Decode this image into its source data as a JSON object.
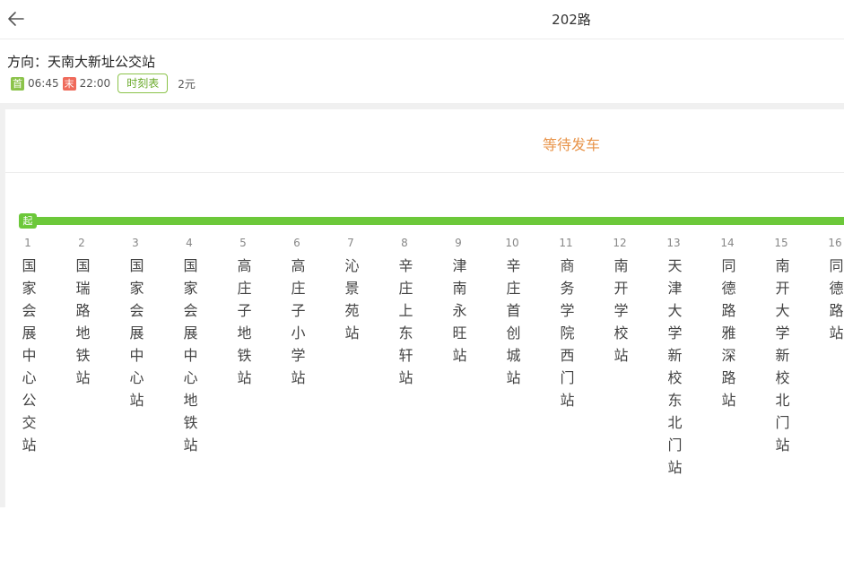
{
  "header": {
    "title": "202路"
  },
  "info": {
    "direction_label": "方向：",
    "direction_value": "天南大新址公交站",
    "first_badge": "首",
    "first_time": "06:45",
    "last_badge": "末",
    "last_time": "22:00",
    "timetable_label": "时刻表",
    "fare": "2元"
  },
  "status": {
    "text": "等待发车"
  },
  "route": {
    "start_badge": "起",
    "stations": [
      {
        "num": "1",
        "name": "国家会展中心公交站"
      },
      {
        "num": "2",
        "name": "国瑞路地铁站"
      },
      {
        "num": "3",
        "name": "国家会展中心站"
      },
      {
        "num": "4",
        "name": "国家会展中心地铁站"
      },
      {
        "num": "5",
        "name": "高庄子地铁站"
      },
      {
        "num": "6",
        "name": "高庄子小学站"
      },
      {
        "num": "7",
        "name": "沁景苑站"
      },
      {
        "num": "8",
        "name": "辛庄上东轩站"
      },
      {
        "num": "9",
        "name": "津南永旺站"
      },
      {
        "num": "10",
        "name": "辛庄首创城站"
      },
      {
        "num": "11",
        "name": "商务学院西门站"
      },
      {
        "num": "12",
        "name": "南开学校站"
      },
      {
        "num": "13",
        "name": "天津大学新校东北门站"
      },
      {
        "num": "14",
        "name": "同德路雅深路站"
      },
      {
        "num": "15",
        "name": "南开大学新校北门站"
      },
      {
        "num": "16",
        "name": "同德路站"
      }
    ]
  },
  "colors": {
    "route_green": "#6cc83a",
    "status_orange": "#e8944a",
    "first_green": "#8bc34a",
    "last_red": "#ef6a5a"
  }
}
